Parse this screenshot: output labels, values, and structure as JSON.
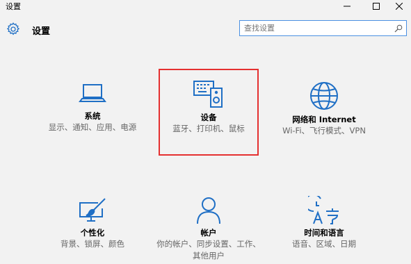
{
  "window": {
    "title": "设置"
  },
  "header": {
    "title": "设置"
  },
  "search": {
    "placeholder": "查找设置"
  },
  "tiles": [
    {
      "title": "系统",
      "desc": "显示、通知、应用、电源"
    },
    {
      "title": "设备",
      "desc": "蓝牙、打印机、鼠标"
    },
    {
      "title": "网络和 Internet",
      "desc": "Wi-Fi、飞行模式、VPN"
    },
    {
      "title": "个性化",
      "desc": "背景、锁屏、颜色"
    },
    {
      "title": "帐户",
      "desc": "你的帐户、同步设置、工作、其他用户"
    },
    {
      "title": "时间和语言",
      "desc": "语音、区域、日期"
    }
  ],
  "colors": {
    "accent": "#1f6fc5",
    "highlight": "#e53030",
    "background": "#f2f2f2"
  },
  "icons": [
    "gear-icon",
    "search-icon",
    "laptop-icon",
    "keyboard-speaker-icon",
    "globe-icon",
    "paintbrush-screen-icon",
    "person-icon",
    "clock-language-icon"
  ]
}
